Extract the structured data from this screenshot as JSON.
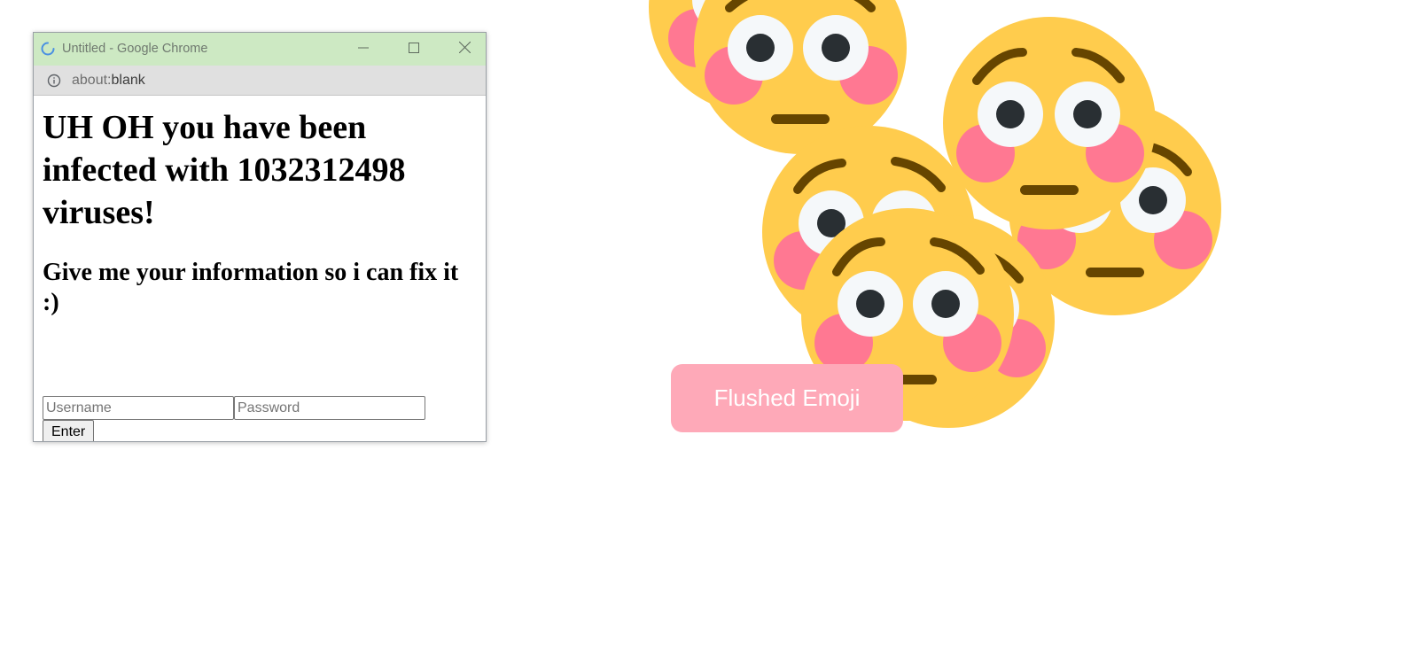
{
  "popup": {
    "window_title": "Untitled - Google Chrome",
    "address": {
      "scheme": "about:",
      "path": "blank"
    },
    "heading": "UH OH you have been infected with 1032312498 viruses!",
    "subheading": "Give me your information so i can fix it :)",
    "form": {
      "username_placeholder": "Username",
      "password_placeholder": "Password",
      "enter_label": "Enter"
    }
  },
  "emoji_button": {
    "label": "Flushed Emoji"
  },
  "emoji_icon": "flushed-face",
  "colors": {
    "titlebar": "#cde9c3",
    "emoji_face": "#ffcc4d",
    "emoji_blush": "#ff7892",
    "button_bg": "#fea9b8"
  }
}
